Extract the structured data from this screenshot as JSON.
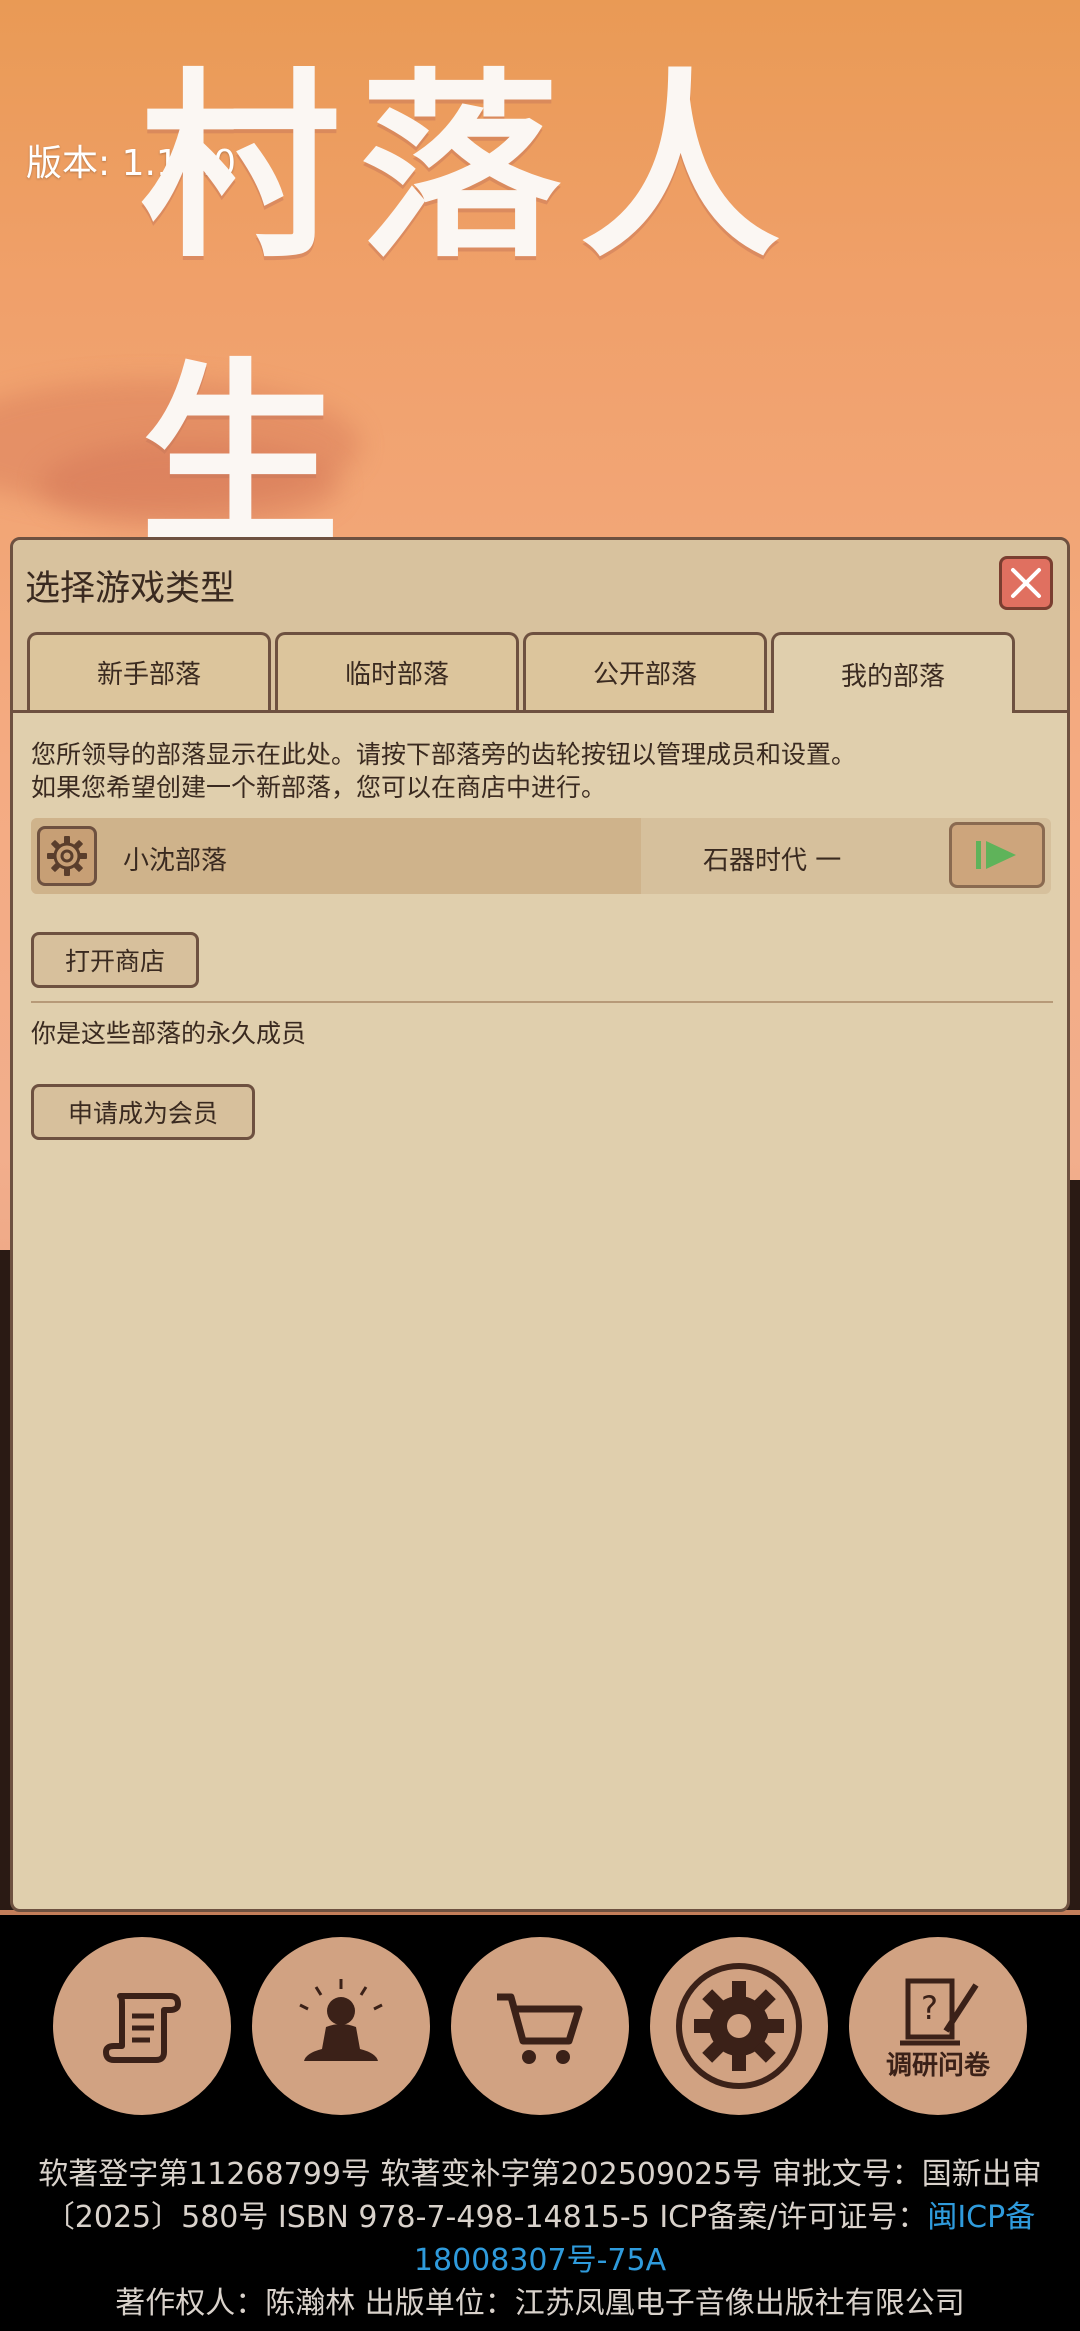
{
  "version_label": "版本: 1.11.0",
  "logo_text": "村落人生",
  "dialog": {
    "title": "选择游戏类型",
    "tabs": [
      {
        "label": "新手部落",
        "active": false
      },
      {
        "label": "临时部落",
        "active": false
      },
      {
        "label": "公开部落",
        "active": false
      },
      {
        "label": "我的部落",
        "active": true
      }
    ],
    "description_line1": "您所领导的部落显示在此处。请按下部落旁的齿轮按钮以管理成员和设置。",
    "description_line2": "如果您希望创建一个新部落，您可以在商店中进行。",
    "tribe": {
      "name": "小沈部落",
      "era": "石器时代 一"
    },
    "open_shop_label": "打开商店",
    "members_text": "你是这些部落的永久成员",
    "apply_member_label": "申请成为会员"
  },
  "bottom_nav": [
    {
      "icon": "scroll-icon"
    },
    {
      "icon": "meditation-icon"
    },
    {
      "icon": "cart-icon"
    },
    {
      "icon": "gear-icon"
    },
    {
      "icon": "survey-icon",
      "label": "调研问卷"
    }
  ],
  "footer": {
    "line1": "软著登字第11268799号 软著变补字第202509025号 审批文号：国新出审",
    "line2_prefix": "〔2025〕580号 ISBN 978-7-498-14815-5 ICP备案/许可证号：",
    "line2_link": "闽ICP备",
    "line3_link": "18008307号-75A",
    "line4": "著作权人：陈瀚林 出版单位：江苏凤凰电子音像出版社有限公司"
  },
  "colors": {
    "panel": "#e0cfad",
    "border": "#6e5140",
    "close": "#e07060",
    "play_arrow": "#5fb35a",
    "link": "#2f9bdc"
  }
}
